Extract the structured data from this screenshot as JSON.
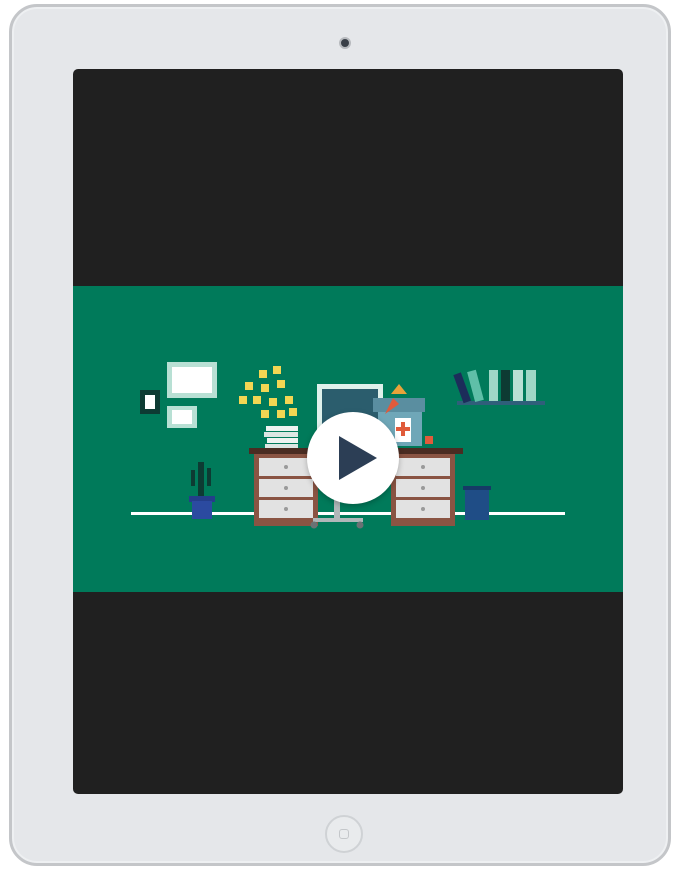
{
  "device": {
    "type": "tablet",
    "frame_color": "#e5e7ea",
    "screen_color": "#202020"
  },
  "video": {
    "background_color": "#007a5a",
    "scene": "office-desk-illustration",
    "play_icon": "play-icon"
  },
  "icons": {
    "camera": "camera-icon",
    "home": "home-button-icon",
    "play": "play-icon"
  }
}
